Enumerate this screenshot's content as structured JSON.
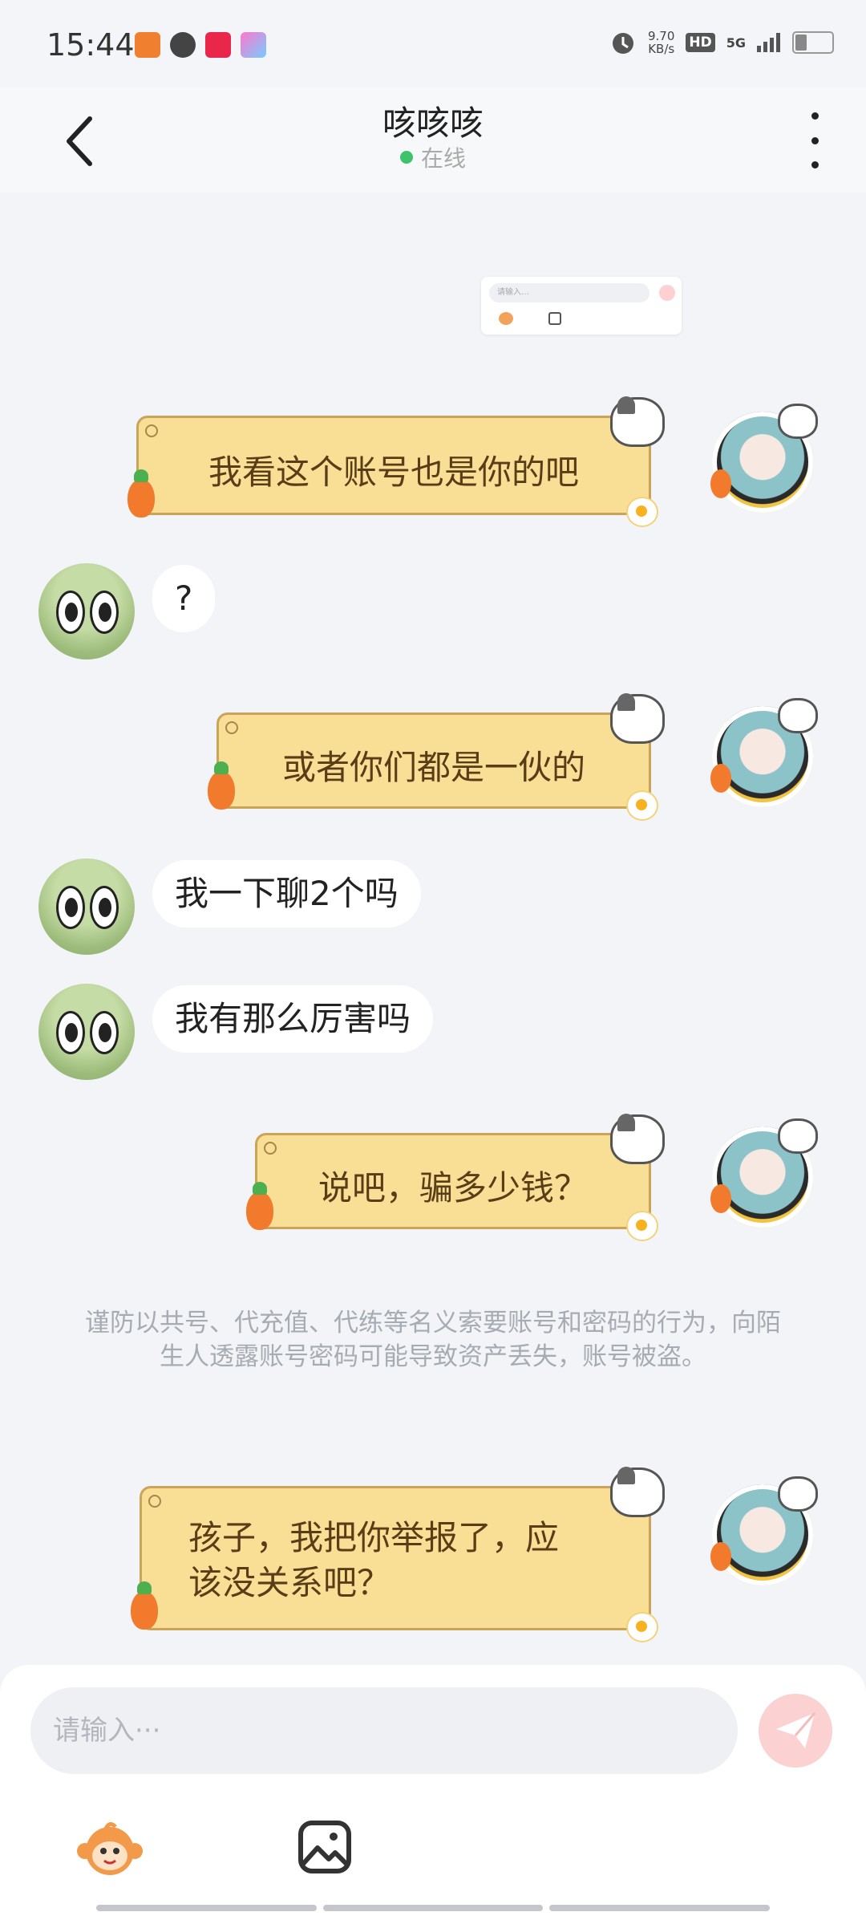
{
  "status_bar": {
    "time": "15:44",
    "net_speed": "9.70",
    "net_unit": "KB/s",
    "hd": "HD",
    "network": "5G",
    "app_icons": [
      "duoduo-app-icon",
      "link-app-icon",
      "xiaohongshu-app-icon",
      "game-app-icon"
    ]
  },
  "header": {
    "title": "咳咳咳",
    "status": "在线",
    "back_icon": "chevron-left-icon",
    "more_icon": "more-vertical-icon"
  },
  "shared_screenshot": {
    "placeholder": "请输入…"
  },
  "messages": [
    {
      "from": "me",
      "text": "我看这个账号也是你的吧"
    },
    {
      "from": "other",
      "text": "?"
    },
    {
      "from": "me",
      "text": "或者你们都是一伙的"
    },
    {
      "from": "other",
      "text": "我一下聊2个吗"
    },
    {
      "from": "other",
      "text": "我有那么厉害吗"
    },
    {
      "from": "me",
      "text": "说吧，骗多少钱？"
    },
    {
      "from": "me",
      "line1": "孩子，我把你举报了，应",
      "line2": "该没关系吧？"
    }
  ],
  "notice": {
    "text": "谨防以共号、代充值、代练等名义索要账号和密码的行为，向陌生人透露账号密码可能导致资产丢失，账号被盗。"
  },
  "input_bar": {
    "placeholder": "请输入···",
    "send_icon": "paper-plane-icon",
    "emoji_icon": "monkey-emoji-icon",
    "image_icon": "image-icon"
  },
  "colors": {
    "online": "#3ec26a",
    "my_bubble": "#f9df96",
    "my_bubble_border": "#c9a45a",
    "send_button": "#fbd1d1"
  }
}
